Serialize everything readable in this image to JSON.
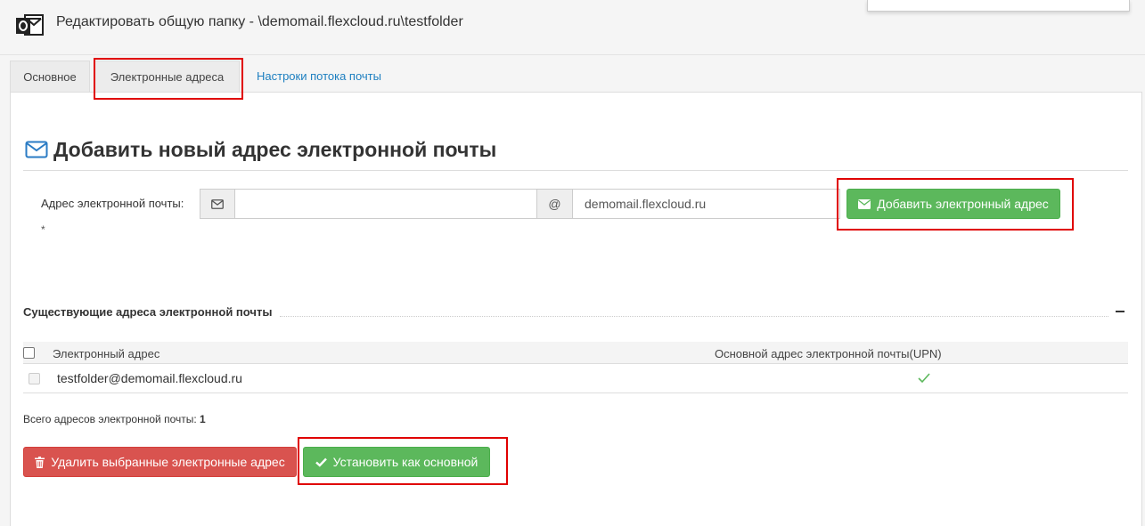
{
  "header": {
    "app_icon": "outlook-icon",
    "title": "Редактировать общую папку - \\demomail.flexcloud.ru\\testfolder"
  },
  "tabs": [
    {
      "label": "Основное"
    },
    {
      "label": "Электронные адреса",
      "active": true
    },
    {
      "label": "Настроки потока почты"
    }
  ],
  "add_section": {
    "title": "Добавить новый адрес электронной почты",
    "title_icon": "envelope-icon",
    "field_label": "Адрес электронной почты:",
    "required_mark": "*",
    "local_part_value": "",
    "at_symbol": "@",
    "domain_value": "demomail.flexcloud.ru",
    "add_button_label": "Добавить электронный адрес"
  },
  "existing_section": {
    "title": "Существующие адреса электронной почты",
    "collapse_symbol": "−",
    "columns": [
      "Электронный адрес",
      "Основной адрес электронной почты(UPN)"
    ],
    "rows": [
      {
        "email": "testfolder@demomail.flexcloud.ru",
        "is_primary": true
      }
    ],
    "total_label": "Всего адресов электронной почты:",
    "total_count": "1"
  },
  "actions": {
    "delete_label": "Удалить выбранные электронные адрес",
    "set_primary_label": "Установить как основной"
  },
  "colors": {
    "accent_green": "#5cb85c",
    "danger_red": "#d9534f",
    "link_blue": "#1d7fc0",
    "highlight_red": "#e00000"
  }
}
